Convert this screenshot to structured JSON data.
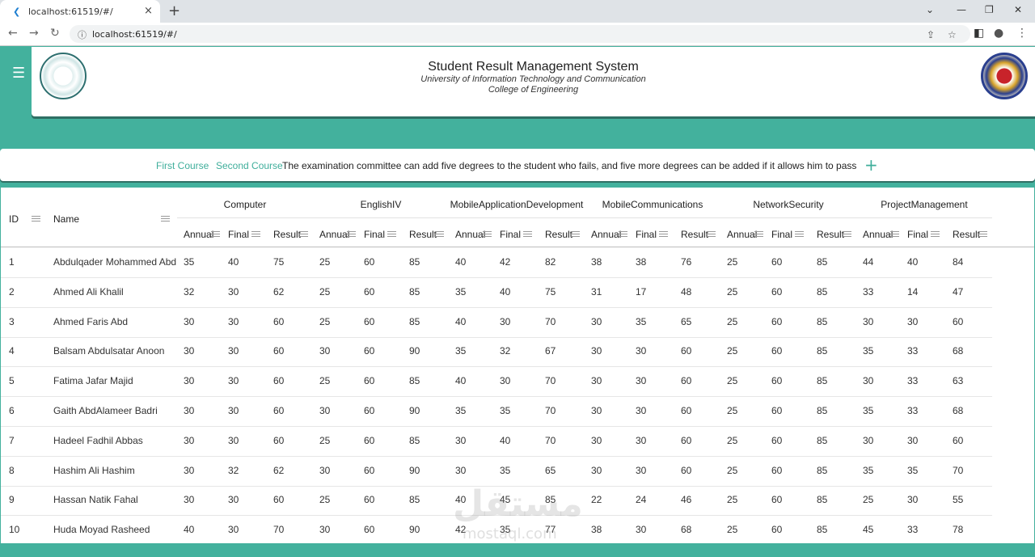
{
  "browser": {
    "tab_title": "localhost:61519/#/",
    "url": "localhost:61519/#/",
    "new_tab_icon": "+",
    "close_icon": "×"
  },
  "header": {
    "title": "Student Result Management System",
    "subtitle1": "University of Information Technology and Communication",
    "subtitle2": "College of Engineering"
  },
  "courses": {
    "first": "First Course",
    "second": "Second Course",
    "note": "The examination committee can add five degrees to the student who fails, and five more degrees can be added if it allows him to pass"
  },
  "table": {
    "id_header": "ID",
    "name_header": "Name",
    "groups": [
      "Computer",
      "EnglishIV",
      "MobileApplicationDevelopment",
      "MobileCommunications",
      "NetworkSecurity",
      "ProjectManagement"
    ],
    "sub_headers": [
      "Annual",
      "Final",
      "Result"
    ],
    "rows": [
      {
        "id": "1",
        "name": "Abdulqader Mohammed Abd",
        "v": [
          "35",
          "40",
          "75",
          "25",
          "60",
          "85",
          "40",
          "42",
          "82",
          "38",
          "38",
          "76",
          "25",
          "60",
          "85",
          "44",
          "40",
          "84"
        ]
      },
      {
        "id": "2",
        "name": "Ahmed Ali Khalil",
        "v": [
          "32",
          "30",
          "62",
          "25",
          "60",
          "85",
          "35",
          "40",
          "75",
          "31",
          "17",
          "48",
          "25",
          "60",
          "85",
          "33",
          "14",
          "47"
        ]
      },
      {
        "id": "3",
        "name": "Ahmed Faris Abd",
        "v": [
          "30",
          "30",
          "60",
          "25",
          "60",
          "85",
          "40",
          "30",
          "70",
          "30",
          "35",
          "65",
          "25",
          "60",
          "85",
          "30",
          "30",
          "60"
        ]
      },
      {
        "id": "4",
        "name": "Balsam Abdulsatar Anoon",
        "v": [
          "30",
          "30",
          "60",
          "30",
          "60",
          "90",
          "35",
          "32",
          "67",
          "30",
          "30",
          "60",
          "25",
          "60",
          "85",
          "35",
          "33",
          "68"
        ]
      },
      {
        "id": "5",
        "name": "Fatima Jafar Majid",
        "v": [
          "30",
          "30",
          "60",
          "25",
          "60",
          "85",
          "40",
          "30",
          "70",
          "30",
          "30",
          "60",
          "25",
          "60",
          "85",
          "30",
          "33",
          "63"
        ]
      },
      {
        "id": "6",
        "name": "Gaith AbdAlameer Badri",
        "v": [
          "30",
          "30",
          "60",
          "30",
          "60",
          "90",
          "35",
          "35",
          "70",
          "30",
          "30",
          "60",
          "25",
          "60",
          "85",
          "35",
          "33",
          "68"
        ]
      },
      {
        "id": "7",
        "name": "Hadeel Fadhil Abbas",
        "v": [
          "30",
          "30",
          "60",
          "25",
          "60",
          "85",
          "30",
          "40",
          "70",
          "30",
          "30",
          "60",
          "25",
          "60",
          "85",
          "30",
          "30",
          "60"
        ]
      },
      {
        "id": "8",
        "name": "Hashim Ali Hashim",
        "v": [
          "30",
          "32",
          "62",
          "30",
          "60",
          "90",
          "30",
          "35",
          "65",
          "30",
          "30",
          "60",
          "25",
          "60",
          "85",
          "35",
          "35",
          "70"
        ]
      },
      {
        "id": "9",
        "name": "Hassan Natik Fahal",
        "v": [
          "30",
          "30",
          "60",
          "25",
          "60",
          "85",
          "40",
          "45",
          "85",
          "22",
          "24",
          "46",
          "25",
          "60",
          "85",
          "25",
          "30",
          "55"
        ]
      },
      {
        "id": "10",
        "name": "Huda Moyad Rasheed",
        "v": [
          "40",
          "30",
          "70",
          "30",
          "60",
          "90",
          "42",
          "35",
          "77",
          "38",
          "30",
          "68",
          "25",
          "60",
          "85",
          "45",
          "33",
          "78"
        ]
      }
    ]
  },
  "watermark": {
    "main": "مستقل",
    "sub": "mostaql.com"
  }
}
